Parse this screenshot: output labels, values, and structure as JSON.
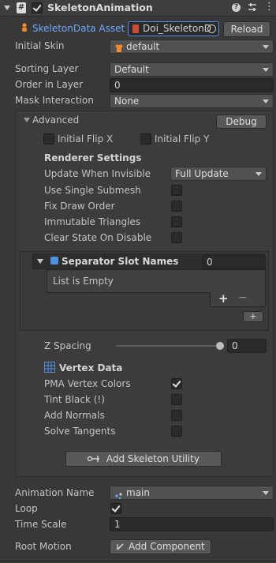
{
  "header": {
    "component_name": "SkeletonAnimation",
    "enabled": true
  },
  "skeleton_data": {
    "label": "SkeletonData Asset",
    "asset": "Doi_SkeletonD",
    "reload_label": "Reload"
  },
  "initial_skin": {
    "label": "Initial Skin",
    "value": "default"
  },
  "sorting_layer": {
    "label": "Sorting Layer",
    "value": "Default"
  },
  "order_in_layer": {
    "label": "Order in Layer",
    "value": "0"
  },
  "mask_interaction": {
    "label": "Mask Interaction",
    "value": "None"
  },
  "advanced": {
    "label": "Advanced",
    "debug_label": "Debug",
    "initial_flip_x": {
      "label": "Initial Flip X",
      "checked": false
    },
    "initial_flip_y": {
      "label": "Initial Flip Y",
      "checked": false
    },
    "renderer_settings": {
      "title": "Renderer Settings",
      "update_when_invisible": {
        "label": "Update When Invisible",
        "value": "Full Update"
      },
      "use_single_submesh": {
        "label": "Use Single Submesh",
        "checked": false
      },
      "fix_draw_order": {
        "label": "Fix Draw Order",
        "checked": false
      },
      "immutable_triangles": {
        "label": "Immutable Triangles",
        "checked": false
      },
      "clear_state_on_disable": {
        "label": "Clear State On Disable",
        "checked": false
      }
    },
    "separator_slots": {
      "label": "Separator Slot Names",
      "count": "0",
      "empty_text": "List is Empty",
      "add": "+",
      "remove": "−",
      "add_small": "+"
    },
    "z_spacing": {
      "label": "Z Spacing",
      "value": "0",
      "slider_fraction": 1.0
    },
    "vertex_data": {
      "title": "Vertex Data",
      "pma_vertex_colors": {
        "label": "PMA Vertex Colors",
        "checked": true
      },
      "tint_black": {
        "label": "Tint Black (!)",
        "checked": false
      },
      "add_normals": {
        "label": "Add Normals",
        "checked": false
      },
      "solve_tangents": {
        "label": "Solve Tangents",
        "checked": false
      }
    },
    "add_skeleton_utility_label": "Add Skeleton Utility"
  },
  "animation_name": {
    "label": "Animation Name",
    "value": "main"
  },
  "loop": {
    "label": "Loop",
    "checked": true
  },
  "time_scale": {
    "label": "Time Scale",
    "value": "1"
  },
  "root_motion": {
    "label": "Root Motion",
    "button_label": "Add Component"
  },
  "colors": {
    "background": "#383838",
    "accent_blue": "#6fa8ff",
    "spine_orange": "#f08a2c"
  }
}
